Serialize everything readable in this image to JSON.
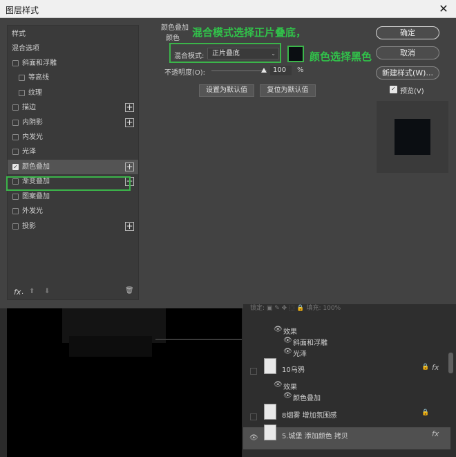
{
  "window": {
    "title": "图层样式",
    "close_glyph": "✕"
  },
  "style_list": {
    "header": "样式",
    "blend_options": "混合选项",
    "items": [
      {
        "label": "斜面和浮雕",
        "checked": false,
        "plus": false
      },
      {
        "label": "等高线",
        "checked": false,
        "plus": false
      },
      {
        "label": "纹理",
        "checked": false,
        "plus": false
      },
      {
        "label": "描边",
        "checked": false,
        "plus": true
      },
      {
        "label": "内阴影",
        "checked": false,
        "plus": true
      },
      {
        "label": "内发光",
        "checked": false,
        "plus": false
      },
      {
        "label": "光泽",
        "checked": false,
        "plus": false
      },
      {
        "label": "颜色叠加",
        "checked": true,
        "plus": true
      },
      {
        "label": "渐变叠加",
        "checked": false,
        "plus": true
      },
      {
        "label": "图案叠加",
        "checked": false,
        "plus": false
      },
      {
        "label": "外发光",
        "checked": false,
        "plus": false
      },
      {
        "label": "投影",
        "checked": false,
        "plus": true
      }
    ],
    "plus_glyph": "+",
    "footer": {
      "fx": "fx",
      "fx_dot": ".",
      "up": "⬆",
      "down": "⬇",
      "trash": "🗑"
    }
  },
  "settings": {
    "section_title": "颜色叠加",
    "sub_title": "颜色",
    "blend_mode_label": "混合模式:",
    "blend_mode_value": "正片叠底",
    "blend_mode_arrow": "⌄",
    "swatch_color": "#0b0e12",
    "opacity_label": "不透明度(O):",
    "opacity_value": "100",
    "opacity_unit": "%",
    "opacity_percent": 100,
    "set_default": "设置为默认值",
    "reset_default": "复位为默认值"
  },
  "annotations": {
    "a1": "混合模式选择正片叠底，",
    "a2": "颜色选择黑色",
    "color": "#31c24a"
  },
  "buttons": {
    "ok": "确定",
    "cancel": "取消",
    "new_style": "新建样式(W)...",
    "preview_label": "预览(V)",
    "preview_checked": true
  },
  "layers_panel": {
    "lock_row": "锁定:  ▣  ✎  ✥  ⬚  🔒    填充:  100%",
    "rows": [
      {
        "type": "sub",
        "text": "效果"
      },
      {
        "type": "subitem",
        "text": "斜面和浮雕"
      },
      {
        "type": "subitem",
        "text": "光泽"
      },
      {
        "type": "layer",
        "text": "10乌鸦",
        "fx": true,
        "lock": true
      },
      {
        "type": "sub",
        "text": "效果"
      },
      {
        "type": "subitem",
        "text": "颜色叠加"
      },
      {
        "type": "layer",
        "text": "8烟雾 增加氛围感",
        "fx": false,
        "lock": true
      },
      {
        "type": "layer-active",
        "text": "5.城堡 添加颜色 拷贝",
        "fx": true,
        "lock": false
      }
    ],
    "eye_glyph": "👁",
    "fx_glyph": "fx",
    "lock_glyph": "🔒"
  },
  "colors": {
    "highlight": "#3bb54a",
    "dialog_bg": "#424242"
  }
}
